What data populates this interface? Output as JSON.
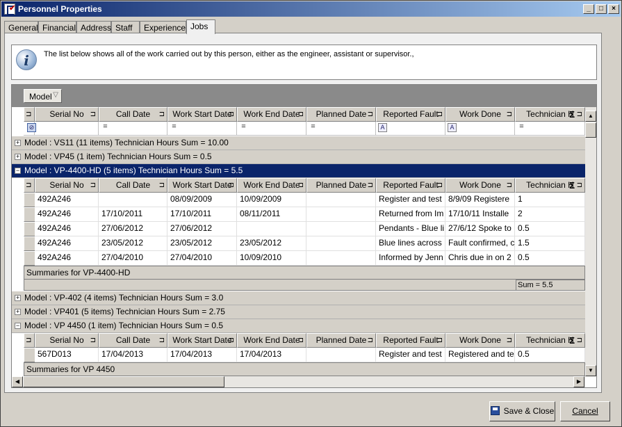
{
  "window": {
    "title": "Personnel Properties"
  },
  "tabs": [
    "General",
    "Financial",
    "Address",
    "Staff",
    "Experience",
    "Jobs"
  ],
  "active_tab": "Jobs",
  "info": {
    "text": "The list below shows all of the work carried out by this person, either as the engineer, assistant or supervisor.,"
  },
  "grid": {
    "group_by_button": "Model",
    "columns": [
      "Serial No",
      "Call Date",
      "Work Start Date",
      "Work End Date",
      "Planned Date",
      "Reported Fault",
      "Work Done",
      "Technician H"
    ],
    "groups": [
      {
        "label": "Model : VS11 (11 items) Technician Hours Sum = 10.00",
        "expanded": false
      },
      {
        "label": "Model : VP45 (1 item) Technician Hours Sum = 0.5",
        "expanded": false
      },
      {
        "label": "Model : VP-4400-HD (5 items) Technician Hours Sum = 5.5",
        "expanded": true,
        "selected": true,
        "rows": [
          [
            "492A246",
            "",
            "08/09/2009",
            "10/09/2009",
            "",
            "Register and test",
            "8/9/09  Registere",
            "1"
          ],
          [
            "492A246",
            "17/10/2011",
            "17/10/2011",
            "08/11/2011",
            "",
            "Returned from Im",
            "17/10/11  Installe",
            "2"
          ],
          [
            "492A246",
            "27/06/2012",
            "27/06/2012",
            "",
            "",
            "Pendants - Blue li",
            "27/6/12  Spoke to",
            "0.5"
          ],
          [
            "492A246",
            "23/05/2012",
            "23/05/2012",
            "23/05/2012",
            "",
            "Blue lines across",
            "Fault confirmed, c",
            "1.5"
          ],
          [
            "492A246",
            "27/04/2010",
            "27/04/2010",
            "10/09/2010",
            "",
            "Informed by Jenn",
            "Chris due in on 2",
            "0.5"
          ]
        ],
        "summary_label": "Summaries for VP-4400-HD",
        "summary_value": "Sum = 5.5"
      },
      {
        "label": "Model : VP-402 (4 items) Technician Hours Sum = 3.0",
        "expanded": false
      },
      {
        "label": "Model : VP401 (5 items) Technician Hours Sum = 2.75",
        "expanded": false
      },
      {
        "label": "Model : VP 4450 (1 item) Technician Hours Sum = 0.5",
        "expanded": true,
        "rows": [
          [
            "567D013",
            "17/04/2013",
            "17/04/2013",
            "17/04/2013",
            "",
            "Register and test",
            "Registered and te",
            "0.5"
          ]
        ],
        "summary_label": "Summaries for VP 4450"
      }
    ]
  },
  "buttons": {
    "save_close": "Save & Close",
    "cancel": "Cancel"
  }
}
